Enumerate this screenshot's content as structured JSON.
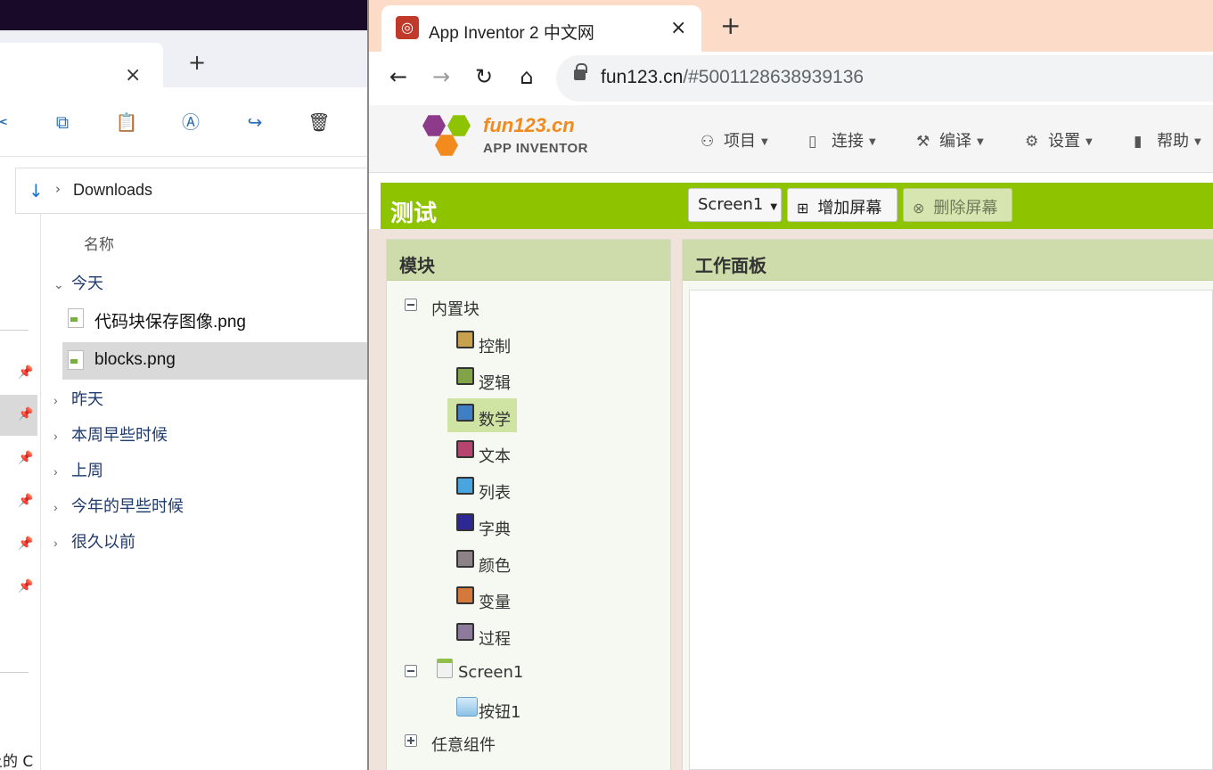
{
  "explorer": {
    "tab_close": "×",
    "new_tab": "+",
    "address": {
      "location": "Downloads"
    },
    "column_header": "名称",
    "groups": [
      {
        "label": "今天",
        "expanded": true
      },
      {
        "label": "昨天",
        "expanded": false
      },
      {
        "label": "本周早些时候",
        "expanded": false
      },
      {
        "label": "上周",
        "expanded": false
      },
      {
        "label": "今年的早些时候",
        "expanded": false
      },
      {
        "label": "很久以前",
        "expanded": false
      }
    ],
    "files": [
      {
        "name": "代码块保存图像.png",
        "selected": false
      },
      {
        "name": "blocks.png",
        "selected": true
      }
    ],
    "bottom_fragment": "上的 C"
  },
  "browser": {
    "tab_title": "App Inventor 2 中文网",
    "tab_close": "×",
    "new_tab": "+",
    "url_host": "fun123.cn",
    "url_rest": "/#5001128638939136"
  },
  "appinventor": {
    "brand": "fun123.cn",
    "subbrand": "APP INVENTOR",
    "menu": [
      {
        "label": "项目",
        "icon": "project-icon"
      },
      {
        "label": "连接",
        "icon": "phone-icon"
      },
      {
        "label": "编译",
        "icon": "tools-icon"
      },
      {
        "label": "设置",
        "icon": "gear-icon"
      },
      {
        "label": "帮助",
        "icon": "book-icon"
      }
    ],
    "project_name": "测试",
    "screen_select": "Screen1",
    "add_screen": "增加屏幕",
    "remove_screen": "删除屏幕",
    "blocks_panel_title": "模块",
    "workspace_title": "工作面板",
    "builtin_label": "内置块",
    "builtin_blocks": [
      {
        "label": "控制",
        "color": "#c7a14e"
      },
      {
        "label": "逻辑",
        "color": "#80a447"
      },
      {
        "label": "数学",
        "color": "#3f80c4",
        "selected": true
      },
      {
        "label": "文本",
        "color": "#b5446f"
      },
      {
        "label": "列表",
        "color": "#4aa4e0"
      },
      {
        "label": "字典",
        "color": "#2d2894"
      },
      {
        "label": "颜色",
        "color": "#8c8288"
      },
      {
        "label": "变量",
        "color": "#d2793b"
      },
      {
        "label": "过程",
        "color": "#8d7a9c"
      }
    ],
    "screen_node": "Screen1",
    "component_node": "按钮1",
    "any_component": "任意组件"
  }
}
